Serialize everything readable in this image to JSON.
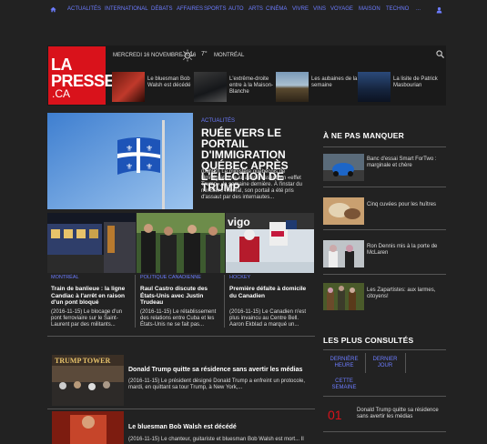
{
  "nav": {
    "items": [
      "ACTUALITÉS",
      "INTERNATIONAL",
      "DÉBATS",
      "AFFAIRES",
      "SPORTS",
      "AUTO",
      "ARTS",
      "CINÉMA",
      "VIVRE",
      "VINS",
      "VOYAGE",
      "MAISON",
      "TECHNO",
      "..."
    ]
  },
  "header": {
    "logo_line1": "LA",
    "logo_line2": "PRESSE",
    "logo_line3": ".CA",
    "date": "MERCREDI 16 NOVEMBRE 2016",
    "temperature": "7°",
    "city": "MONTRÉAL",
    "teasers": [
      "Le bluesman Bob Walsh est décédé",
      "L'extrême-droite entre à la Maison-Blanche",
      "Les aubaines de la semaine",
      "La lisite de Patrick Masbourian"
    ]
  },
  "hero": {
    "category": "ACTUALITÉS",
    "title": "RUÉE VERS LE PORTAIL D'IMMIGRATION QUÉBEC APRÈS L'ÉLECTION DE TRUMP",
    "text": "(00h00) Le ministère québécois de l'Immigration a lui aussi ressenti un «effet Trump», la semaine dernière. À l'instar du ministère fédéral, son portail a été pris d'assaut par des internautes..."
  },
  "stories": [
    {
      "category": "MONTRÉAL",
      "title": "Train de banlieue : la ligne Candiac à l'arrêt en raison d'un pont bloqué",
      "text": "(2016-11-15) Le blocage d'un pont ferroviaire sur le Saint-Laurent par des militants..."
    },
    {
      "category": "POLITIQUE CANADIENNE",
      "title": "Raul Castro discute des États-Unis avec Justin Trudeau",
      "text": "(2016-11-15) Le rétablissement des relations entre Cuba et les États-Unis ne se fait pas..."
    },
    {
      "category": "HOCKEY",
      "title": "Première défaite à domicile du Canadien",
      "text": "(2016-11-15) Le Canadien n'est plus invaincu au Centre Bell. Aaron Ekblad a marqué un..."
    }
  ],
  "list": [
    {
      "title": "Donald Trump quitte sa résidence sans avertir les médias",
      "text": "(2016-11-15) Le président désigné Donald Trump a enfreint un protocole, mardi, en quittant sa tour Trump, à New York,..."
    },
    {
      "title": "Le bluesman Bob Walsh est décédé",
      "text": "(2016-11-15) Le chanteur, guitariste et bluesman Bob Walsh est mort... Il"
    }
  ],
  "right": {
    "head1": "À NE PAS MANQUER",
    "items": [
      "Banc d'essai Smart ForTwo : marginale et chère",
      "Cinq cuvées pour les huîtres",
      "Ron Dennis mis à la porte de McLaren",
      "Les Zapartistes: aux larmes, citoyens!"
    ],
    "head2": "LES PLUS CONSULTÉS",
    "tabs": [
      "DERNIÈRE HEURE",
      "DERNIER JOUR",
      "CETTE SEMAINE"
    ],
    "rank": "01",
    "top_item": "Donald Trump quitte sa résidence sans avertir les médias"
  }
}
